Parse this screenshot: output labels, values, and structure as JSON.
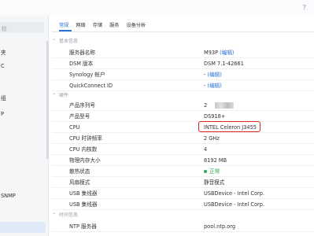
{
  "window": {
    "help": "?"
  },
  "sidebar": {
    "search_text": "较",
    "items": [
      {
        "label": "夹"
      },
      {
        "label": "C"
      },
      {
        "label": "组"
      },
      {
        "label": "P"
      },
      {
        "label": ""
      },
      {
        "label": ""
      },
      {
        "label": "SNMP"
      },
      {
        "label": ""
      },
      {
        "label": ""
      }
    ],
    "active_index": 8
  },
  "tabs": [
    "常规",
    "网络",
    "存储",
    "服务",
    "设备分析"
  ],
  "active_tab": 0,
  "sections": {
    "basic": "基本信息",
    "hardware": "硬件",
    "time": "时间信息"
  },
  "rows": {
    "server_name": {
      "label": "服务器名称",
      "value": "M93P",
      "link": "(编辑)"
    },
    "dsm_version": {
      "label": "DSM 版本",
      "value": "DSM 7.1-42661"
    },
    "synology_account": {
      "label": "Synology 帐户",
      "value": "-",
      "link": "(编辑)"
    },
    "quickconnect": {
      "label": "QuickConnect ID",
      "value": "-",
      "link": "(编辑)"
    },
    "serial": {
      "label": "产品序列号",
      "value": "2"
    },
    "model": {
      "label": "产品型号",
      "value": "DS918+"
    },
    "cpu": {
      "label": "CPU",
      "value": "INTEL Celeron J3455"
    },
    "cpu_freq": {
      "label": "CPU 时钟频率",
      "value": "2 GHz"
    },
    "cpu_cores": {
      "label": "CPU 内核数",
      "value": "4"
    },
    "memory": {
      "label": "物理内存大小",
      "value": "8192 MB"
    },
    "cooling": {
      "label": "散热状态",
      "value": "正常"
    },
    "fan_mode": {
      "label": "风扇模式",
      "value": "静音模式"
    },
    "usb1": {
      "label": "USB 集线器",
      "value": "USBDevice - Intel Corp."
    },
    "usb2": {
      "label": "USB 集线器",
      "value": "USBDevice - Intel Corp."
    },
    "ntp": {
      "label": "NTP 服务器",
      "value": "pool.ntp.org"
    }
  },
  "colors": {
    "accent": "#2b72d6",
    "highlight": "#e0251c",
    "ok": "#2fa84f"
  }
}
